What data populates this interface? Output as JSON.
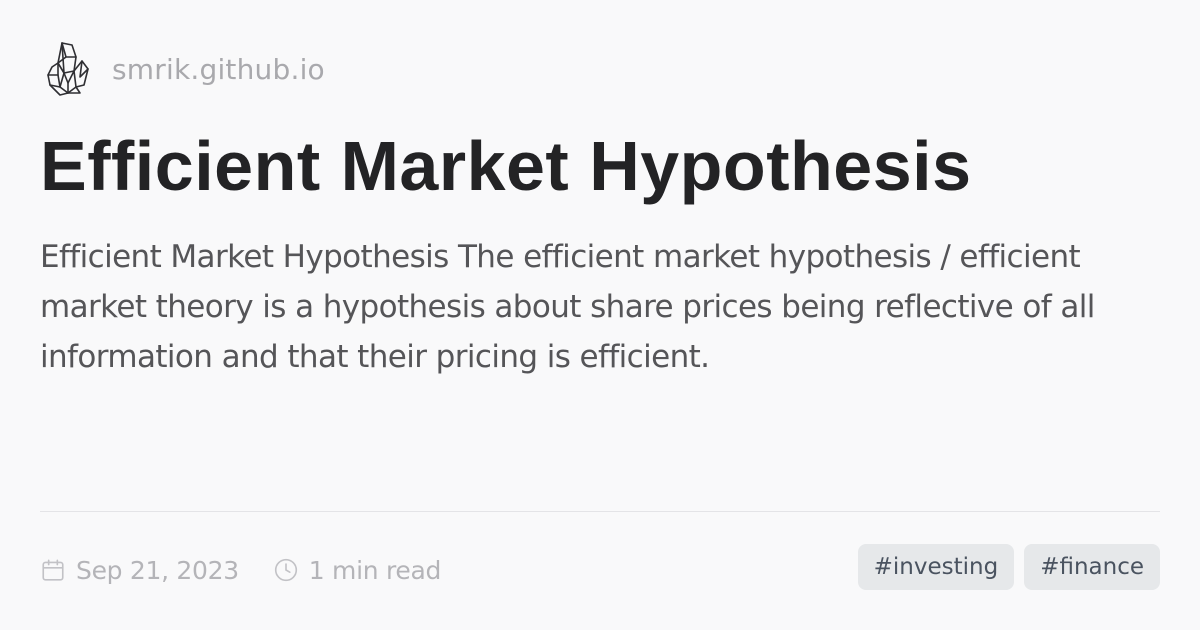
{
  "site": {
    "name": "smrik.github.io",
    "logo_icon": "crystal-cluster-icon"
  },
  "post": {
    "title": "Efficient Market Hypothesis",
    "description": "Efficient Market Hypothesis The efficient market hypothesis / efficient market theory is a hypothesis about share prices being reflective of all information and that their pricing is efficient.",
    "date": "Sep 21, 2023",
    "reading_time": "1 min read",
    "date_icon": "calendar-icon",
    "time_icon": "clock-icon",
    "tags": [
      "#investing",
      "#finance"
    ]
  },
  "colors": {
    "background": "#f9f9fa",
    "title": "#232325",
    "body_text": "#555558",
    "muted_text": "#a9a9ad",
    "tag_background": "#e6e8ea",
    "tag_text": "#4a5360"
  }
}
